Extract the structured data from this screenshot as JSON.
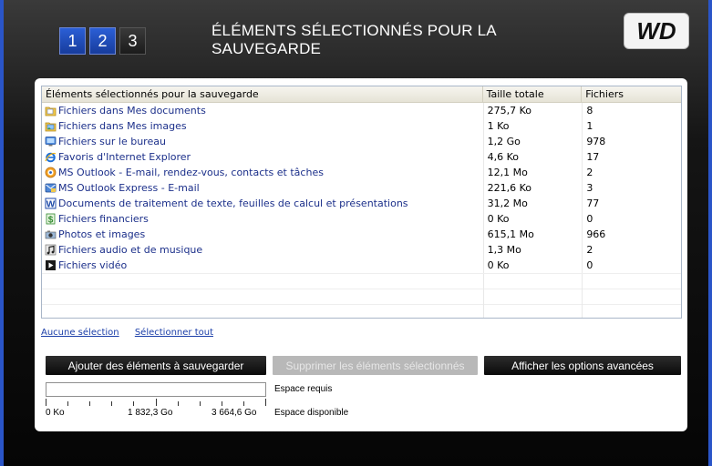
{
  "header": {
    "steps": [
      "1",
      "2",
      "3"
    ],
    "title": "ÉLÉMENTS SÉLECTIONNÉS POUR LA SAUVEGARDE",
    "logo": "WD"
  },
  "list": {
    "columns": [
      "Éléments sélectionnés pour la sauvegarde",
      "Taille totale",
      "Fichiers"
    ],
    "rows": [
      {
        "icon": "my-documents-icon",
        "name": "Fichiers dans Mes documents",
        "size": "275,7 Ko",
        "files": "8"
      },
      {
        "icon": "my-pictures-icon",
        "name": "Fichiers dans Mes images",
        "size": "1 Ko",
        "files": "1"
      },
      {
        "icon": "desktop-icon",
        "name": "Fichiers sur le bureau",
        "size": "1,2 Go",
        "files": "978"
      },
      {
        "icon": "internet-explorer-icon",
        "name": "Favoris d'Internet Explorer",
        "size": "4,6 Ko",
        "files": "17"
      },
      {
        "icon": "outlook-icon",
        "name": "MS Outlook - E-mail, rendez-vous, contacts et tâches",
        "size": "12,1 Mo",
        "files": "2"
      },
      {
        "icon": "outlook-express-icon",
        "name": "MS Outlook Express - E-mail",
        "size": "221,6 Ko",
        "files": "3"
      },
      {
        "icon": "word-document-icon",
        "name": "Documents de traitement de texte, feuilles de calcul et présentations",
        "size": "31,2 Mo",
        "files": "77"
      },
      {
        "icon": "financial-files-icon",
        "name": "Fichiers financiers",
        "size": "0 Ko",
        "files": "0"
      },
      {
        "icon": "photos-icon",
        "name": "Photos et images",
        "size": "615,1 Mo",
        "files": "966"
      },
      {
        "icon": "music-icon",
        "name": "Fichiers audio et de musique",
        "size": "1,3 Mo",
        "files": "2"
      },
      {
        "icon": "video-icon",
        "name": "Fichiers vidéo",
        "size": "0 Ko",
        "files": "0"
      }
    ]
  },
  "links": {
    "select_none": "Aucune sélection",
    "select_all": "Sélectionner tout"
  },
  "buttons": {
    "add": "Ajouter des éléments à sauvegarder",
    "remove": "Supprimer les éléments sélectionnés",
    "advanced": "Afficher les options avancées"
  },
  "space": {
    "required_label": "Espace requis",
    "available_label": "Espace disponible",
    "scale": [
      "0 Ko",
      "1 832,3 Go",
      "3 664,6 Go"
    ]
  },
  "colors": {
    "accent_blue": "#2a55c8",
    "link_blue": "#1b3ea8",
    "item_text": "#1b2f8a"
  }
}
